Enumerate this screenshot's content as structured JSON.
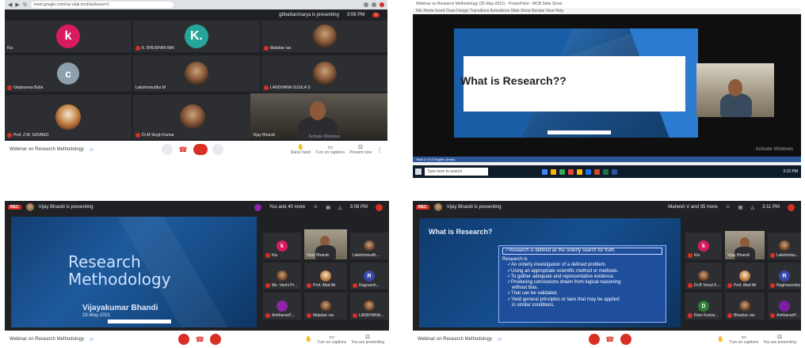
{
  "panel1": {
    "url": "meet.google.com/rqv-ebjk-mcd/authuser=1",
    "top_right": {
      "presenter": "gbhattarcharya is presenting",
      "time": "3:08 PM",
      "notif_count": "1"
    },
    "tiles": [
      {
        "name": "Kiu",
        "letter": "k",
        "color": "#d81b60"
      },
      {
        "name": "K. BHUSHAN MAI",
        "letter": "K.",
        "color": "#26a69a"
      },
      {
        "name": "Malabar ras",
        "letter": "",
        "color": "photo"
      },
      {
        "name": "Ukatsunwa Bulla",
        "letter": "c",
        "color": "#8ea0ad"
      },
      {
        "name": "Lakshmisudha M",
        "letter": "",
        "color": "photo"
      },
      {
        "name": "LANDHANA SUSILA S",
        "letter": "",
        "color": "photo"
      },
      {
        "name": "Prof. Z.M. SUNNED",
        "letter": "",
        "color": "photo"
      },
      {
        "name": "Dr.M Singh Kumar",
        "letter": "",
        "color": "photo"
      },
      {
        "name": "Vijay Bhandi",
        "letter": "",
        "color": "camera"
      }
    ],
    "bottom": {
      "meeting": "Webinar on Research Methodology",
      "captions": "Turn on captions",
      "present": "Present now",
      "raise": "Raise hand",
      "activate": "Activate Windows"
    }
  },
  "panel2": {
    "title": "Webinar on Research Methodology (25-May-2021) - PowerPoint - MCB Slide Show",
    "menu": "File  Home  Insert  Draw  Design  Transitions  Animations  Slide Show  Review  View  Help",
    "slide_title": "What is Research??",
    "status": "Slide 2 of 10   English (India)",
    "search": "Type here to search",
    "activate": "Activate Windows",
    "clock": "3:10 PM"
  },
  "panel3": {
    "presenting": "Vijay Bhandi is presenting",
    "top_right": {
      "you": "You and 40 more",
      "time": "3:08 PM"
    },
    "slide": {
      "title_line1": "Research",
      "title_line2": "Methodology",
      "name": "Vijayakumar Bhandi",
      "date": "29-May-2021"
    },
    "tiles": [
      {
        "name": "Kiu",
        "letter": "k",
        "color": "#d81b60"
      },
      {
        "name": "Vijay Bhandi",
        "letter": "",
        "color": "camera"
      },
      {
        "name": "Lakshmisudh...",
        "letter": "",
        "color": "photo"
      },
      {
        "name": "Ms. Vanhi Pr...",
        "letter": "",
        "color": "photo"
      },
      {
        "name": "Prof. Altaf Ali",
        "letter": "",
        "color": "photo"
      },
      {
        "name": "Ragnarsh...",
        "letter": "R",
        "color": "#3949ab"
      },
      {
        "name": "AnitharanP...",
        "letter": "",
        "color": "photo"
      },
      {
        "name": "Malabar ras",
        "letter": "",
        "color": "photo"
      },
      {
        "name": "LANDHANA...",
        "letter": "",
        "color": "photo"
      }
    ],
    "bottom": {
      "meeting": "Webinar on Research Methodology",
      "captions": "Turn on captions",
      "presenting": "You are presenting"
    }
  },
  "panel4": {
    "presenting": "Vijay Bhandi is presenting",
    "top_right": {
      "you": "Mahesh V and 35 more",
      "time": "3:11 PM"
    },
    "slide": {
      "title": "What is Research?",
      "definition": "✓Research is defined as the orderly search for truth.",
      "research_is": "Research is",
      "points": [
        "✓An orderly investigation of a defined problem.",
        "✓Using an appropriate scientific method or methods.",
        "✓To gather adequate and representative evidence.",
        "✓Producing conclusions drawn from logical reasoning",
        "without bias.",
        "✓That can be validated.",
        "✓Yield general principles or laws that may be applied",
        "in similar conditions."
      ]
    },
    "tiles": [
      {
        "name": "Kiu",
        "letter": "k",
        "color": "#d81b60"
      },
      {
        "name": "Vijay Bhandi",
        "letter": "",
        "color": "camera"
      },
      {
        "name": "Lakshmisu...",
        "letter": "",
        "color": "photo"
      },
      {
        "name": "Dr.B Vinod K...",
        "letter": "",
        "color": "photo"
      },
      {
        "name": "Prof. Altaf Ali",
        "letter": "",
        "color": "photo"
      },
      {
        "name": "Raghavendra",
        "letter": "R",
        "color": "#3949ab"
      },
      {
        "name": "Ram Kumar...",
        "letter": "D",
        "color": "#2e7d32"
      },
      {
        "name": "Bhaskar ras",
        "letter": "",
        "color": "photo"
      },
      {
        "name": "AnitharanP...",
        "letter": "",
        "color": "#7b1fa2"
      }
    ],
    "bottom": {
      "meeting": "Webinar on Research Methodology",
      "captions": "Turn on captions",
      "presenting": "You are presenting"
    }
  }
}
